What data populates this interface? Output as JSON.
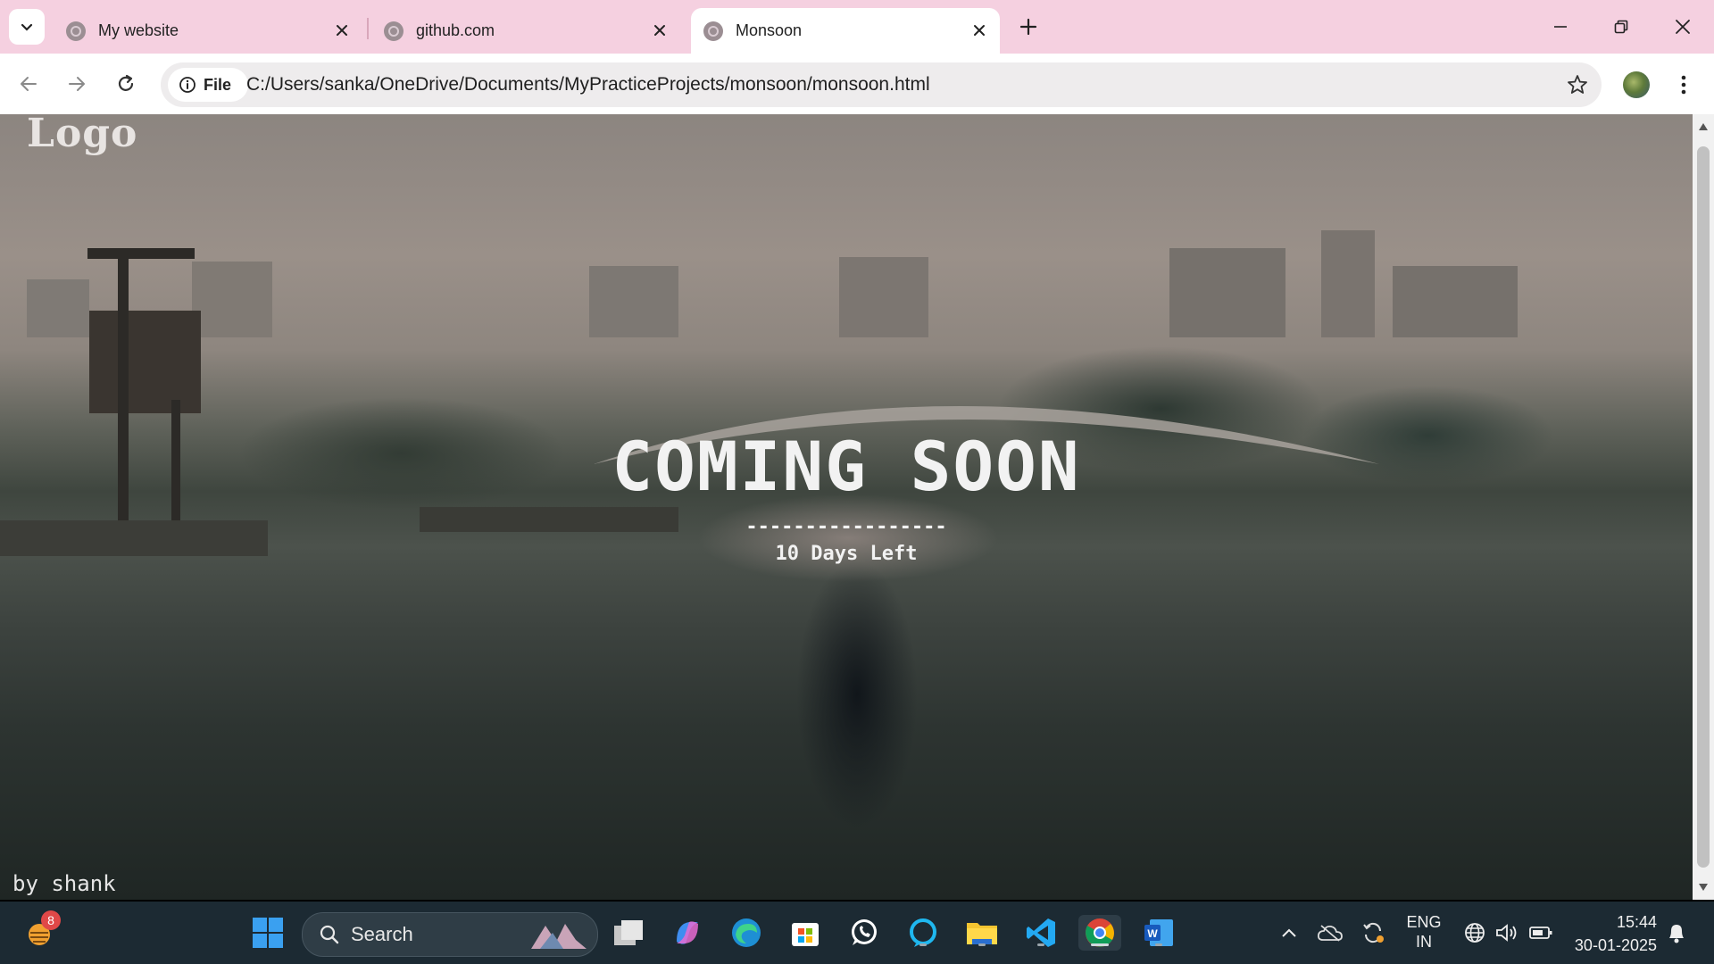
{
  "browser": {
    "tabs": [
      {
        "title": "My website"
      },
      {
        "title": "github.com"
      },
      {
        "title": "Monsoon"
      }
    ],
    "address_chip": "File",
    "url": "C:/Users/sanka/OneDrive/Documents/MyPracticeProjects/monsoon/monsoon.html"
  },
  "page": {
    "logo": "Logo",
    "heading": "COMING SOON",
    "divider": "-----------------",
    "countdown": "10 Days Left",
    "credit": "by shank"
  },
  "taskbar": {
    "weather_badge": "8",
    "search_placeholder": "Search",
    "language_line1": "ENG",
    "language_line2": "IN",
    "time": "15:44",
    "date": "30-01-2025",
    "apps": [
      "file-explorer-like",
      "copilot",
      "edge",
      "microsoft-store",
      "whatsapp",
      "alexa",
      "file-explorer",
      "vscode",
      "chrome",
      "word"
    ]
  },
  "colors": {
    "tabstrip": "#f5d0e0",
    "taskbar": "#1c2a33",
    "heading_text": "#f2f2f2"
  }
}
